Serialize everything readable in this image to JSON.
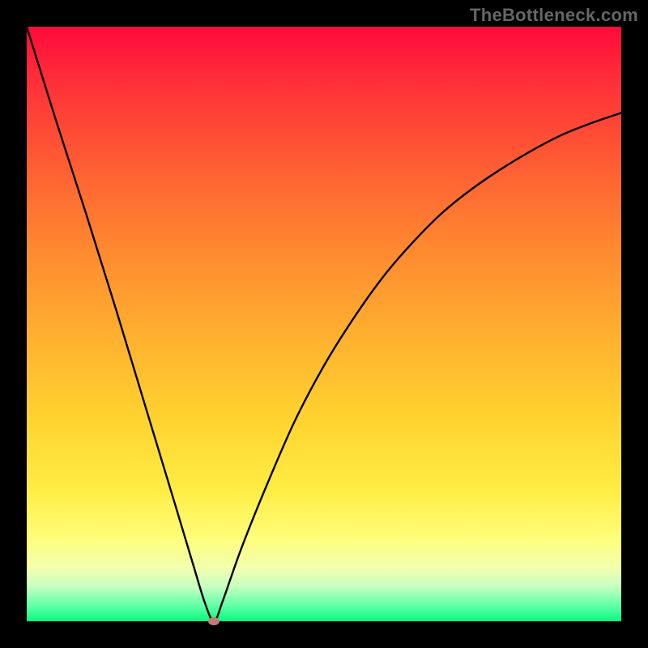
{
  "watermark": "TheBottleneck.com",
  "colors": {
    "frame": "#000000",
    "curve": "#000000",
    "marker": "#c47a72",
    "gradient_stops": [
      "#ff0a3a",
      "#ff2b39",
      "#ff5934",
      "#ff8530",
      "#ffb02f",
      "#ffd32f",
      "#ffed45",
      "#fffe7a",
      "#f2ffae",
      "#caffc0",
      "#8dffb2",
      "#4dffa0",
      "#09f77a"
    ]
  },
  "chart_data": {
    "type": "line",
    "title": "",
    "xlabel": "",
    "ylabel": "",
    "xlim": [
      0,
      100
    ],
    "ylim": [
      0,
      100
    ],
    "grid": false,
    "legend": false,
    "series": [
      {
        "name": "bottleneck-curve",
        "x": [
          0,
          5,
          10,
          15,
          20,
          25,
          28,
          30,
          31.5,
          33,
          36,
          40,
          45,
          50,
          55,
          60,
          65,
          70,
          75,
          80,
          85,
          90,
          95,
          100
        ],
        "y": [
          100,
          84,
          68.5,
          52.5,
          36,
          19.5,
          9.5,
          3,
          0,
          3.5,
          12,
          22,
          33.5,
          43,
          51,
          58,
          63.8,
          68.8,
          72.8,
          76.2,
          79.2,
          81.8,
          83.8,
          85.5
        ]
      }
    ],
    "marker": {
      "x": 31.5,
      "y": 0
    }
  }
}
